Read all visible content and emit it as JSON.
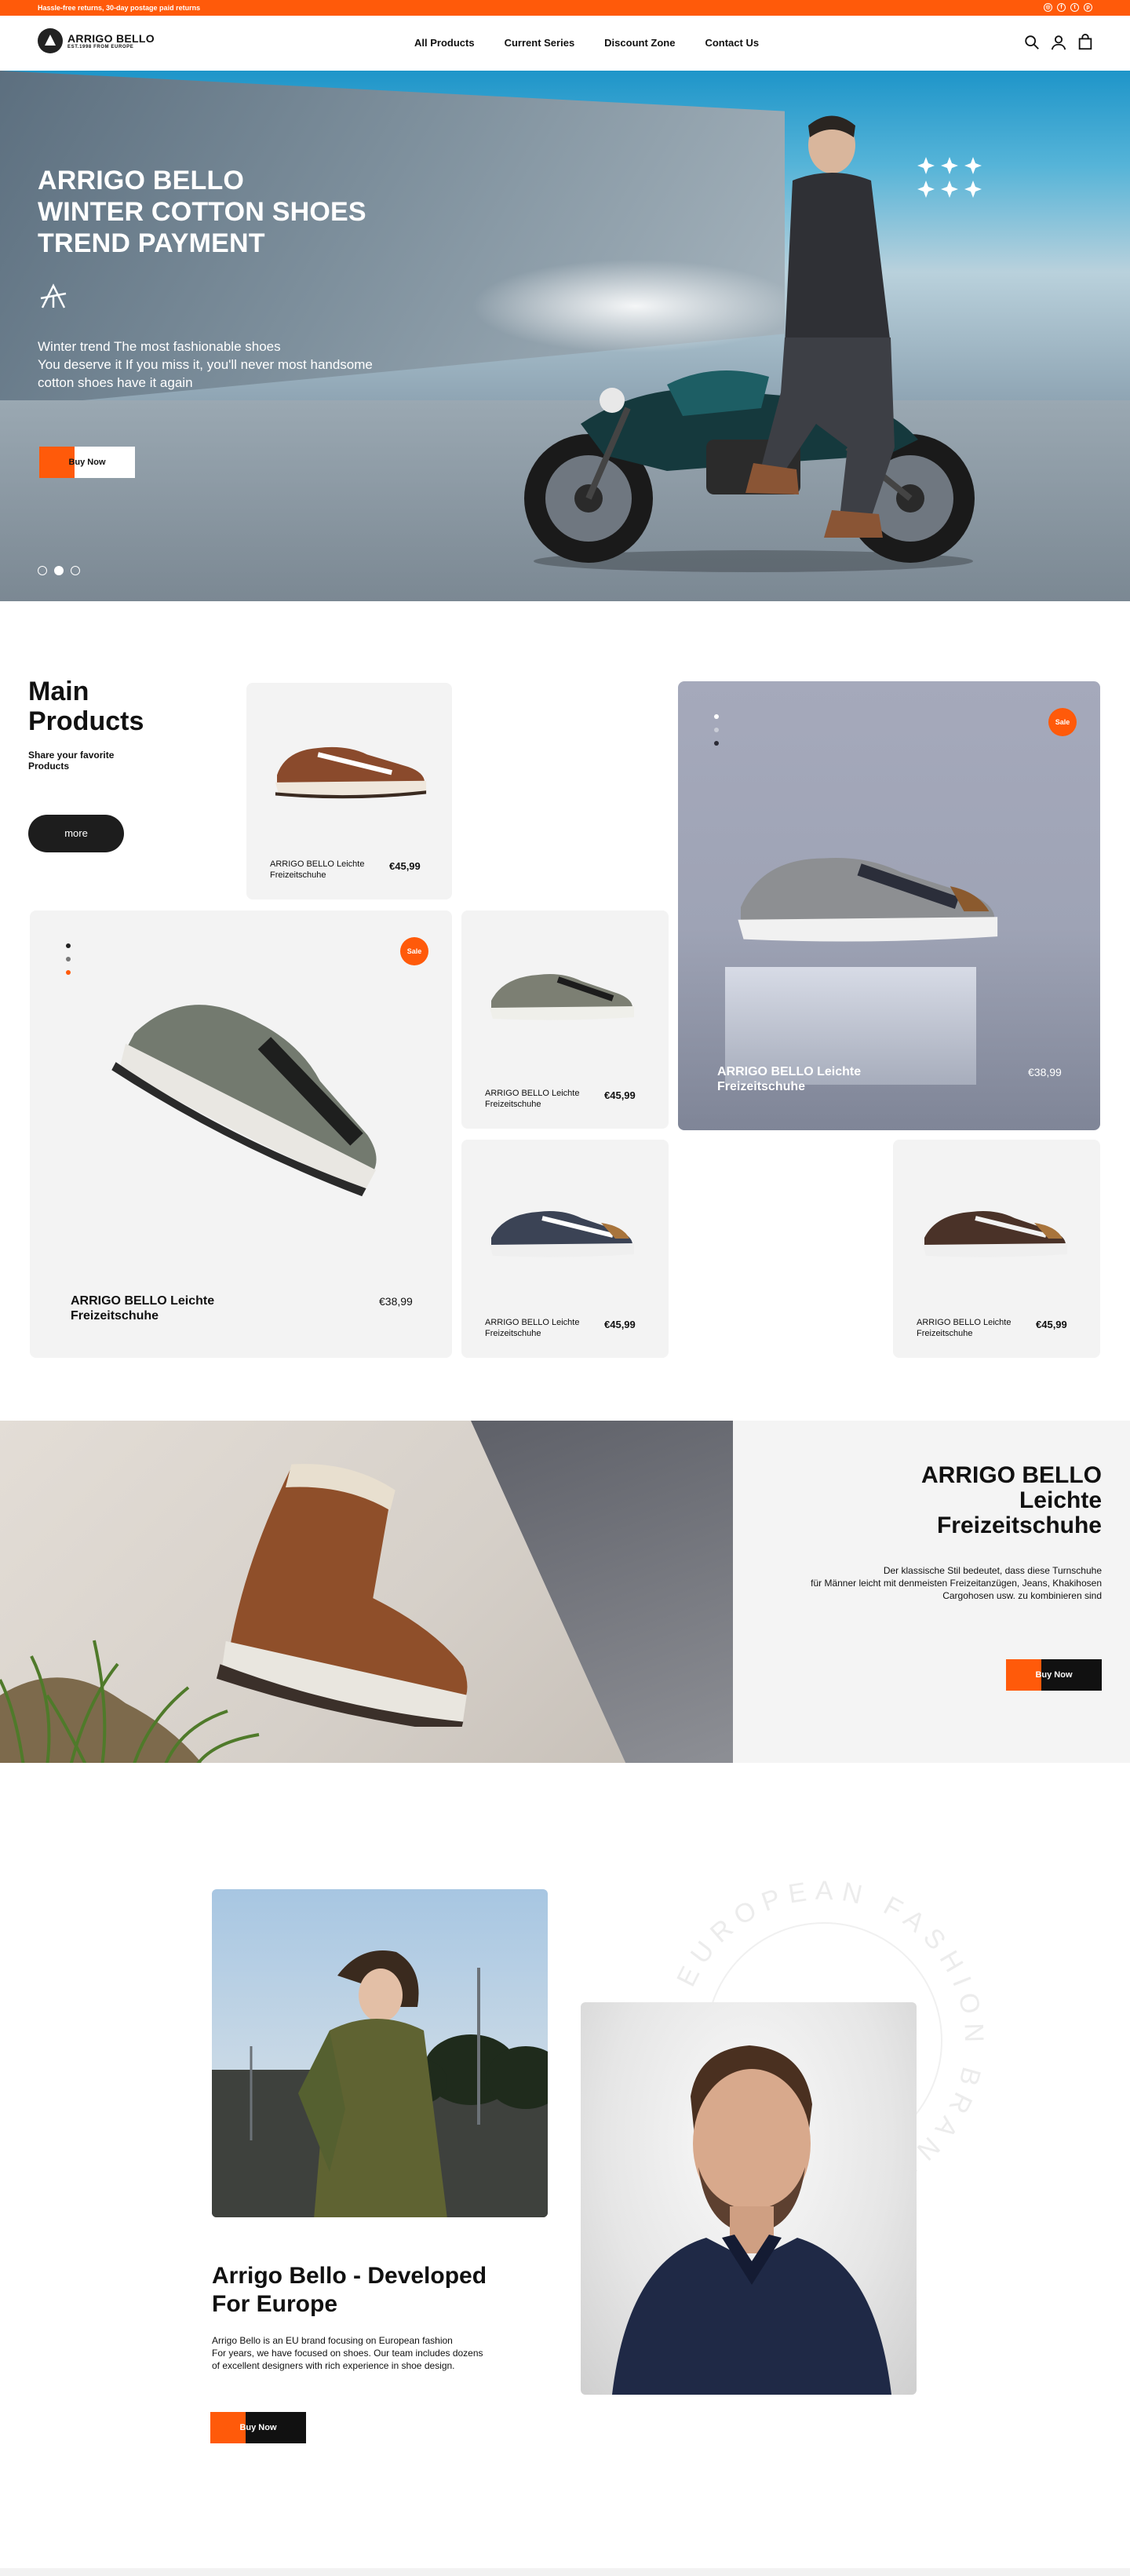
{
  "topbar": {
    "note": "Hassle-free returns, 30-day postage paid returns",
    "social_icons": [
      "instagram-icon",
      "facebook-icon",
      "twitter-icon",
      "pinterest-icon"
    ]
  },
  "header": {
    "logo_name": "ARRIGO BELLO",
    "logo_sub": "EST.1998 FROM EUROPE",
    "nav": [
      "All Products",
      "Current Series",
      "Discount Zone",
      "Contact Us"
    ],
    "icons": [
      "search-icon",
      "user-icon",
      "cart-icon"
    ]
  },
  "hero": {
    "title_line1": "ARRIGO BELLO",
    "title_line2": "WINTER COTTON SHOES",
    "title_line3": "TREND PAYMENT",
    "desc_line1": "Winter trend The most fashionable shoes",
    "desc_line2": "You deserve it If you miss it, you'll never most handsome",
    "desc_line3": "cotton shoes have it again",
    "button": "Buy Now",
    "slides": 3,
    "active_slide": 2
  },
  "main_products": {
    "title_line1": "Main",
    "title_line2": "Products",
    "subtitle_line1": "Share your favorite",
    "subtitle_line2": "Products",
    "more": "more",
    "sale_label": "Sale",
    "cards": [
      {
        "name1": "ARRIGO BELLO Leichte",
        "name2": "Freizeitschuhe",
        "price": "€45,99"
      },
      {
        "name1": "ARRIGO BELLO Leichte",
        "name2": "Freizeitschuhe",
        "price": "€38,99"
      },
      {
        "name1": "ARRIGO BELLO Leichte",
        "name2": "Freizeitschuhe",
        "price": "€38,99"
      },
      {
        "name1": "ARRIGO BELLO Leichte",
        "name2": "Freizeitschuhe",
        "price": "€45,99"
      },
      {
        "name1": "ARRIGO BELLO Leichte",
        "name2": "Freizeitschuhe",
        "price": "€45,99"
      },
      {
        "name1": "ARRIGO BELLO Leichte",
        "name2": "Freizeitschuhe",
        "price": "€45,99"
      }
    ]
  },
  "promo": {
    "title_line1": "ARRIGO BELLO",
    "title_line2": "Leichte",
    "title_line3": "Freizeitschuhe",
    "desc_line1": "Der klassische Stil bedeutet, dass diese Turnschuhe",
    "desc_line2": "für Männer leicht mit denmeisten Freizeitanzügen, Jeans, Khakihosen",
    "desc_line3": "Cargohosen usw. zu kombinieren sind",
    "button": "Buy Now"
  },
  "about": {
    "ring_text": "EUROPEAN FASHION BRAND",
    "title_line1": "Arrigo Bello - Developed",
    "title_line2": "For Europe",
    "desc_line1": "Arrigo Bello is an EU brand focusing on European fashion",
    "desc_line2": "For years, we have focused on shoes. Our team includes dozens",
    "desc_line3": "of excellent designers with rich experience in shoe design.",
    "button": "Buy Now"
  },
  "colors": {
    "accent": "#ff5a0a",
    "dark": "#111111",
    "card_bg": "#f3f3f3"
  }
}
